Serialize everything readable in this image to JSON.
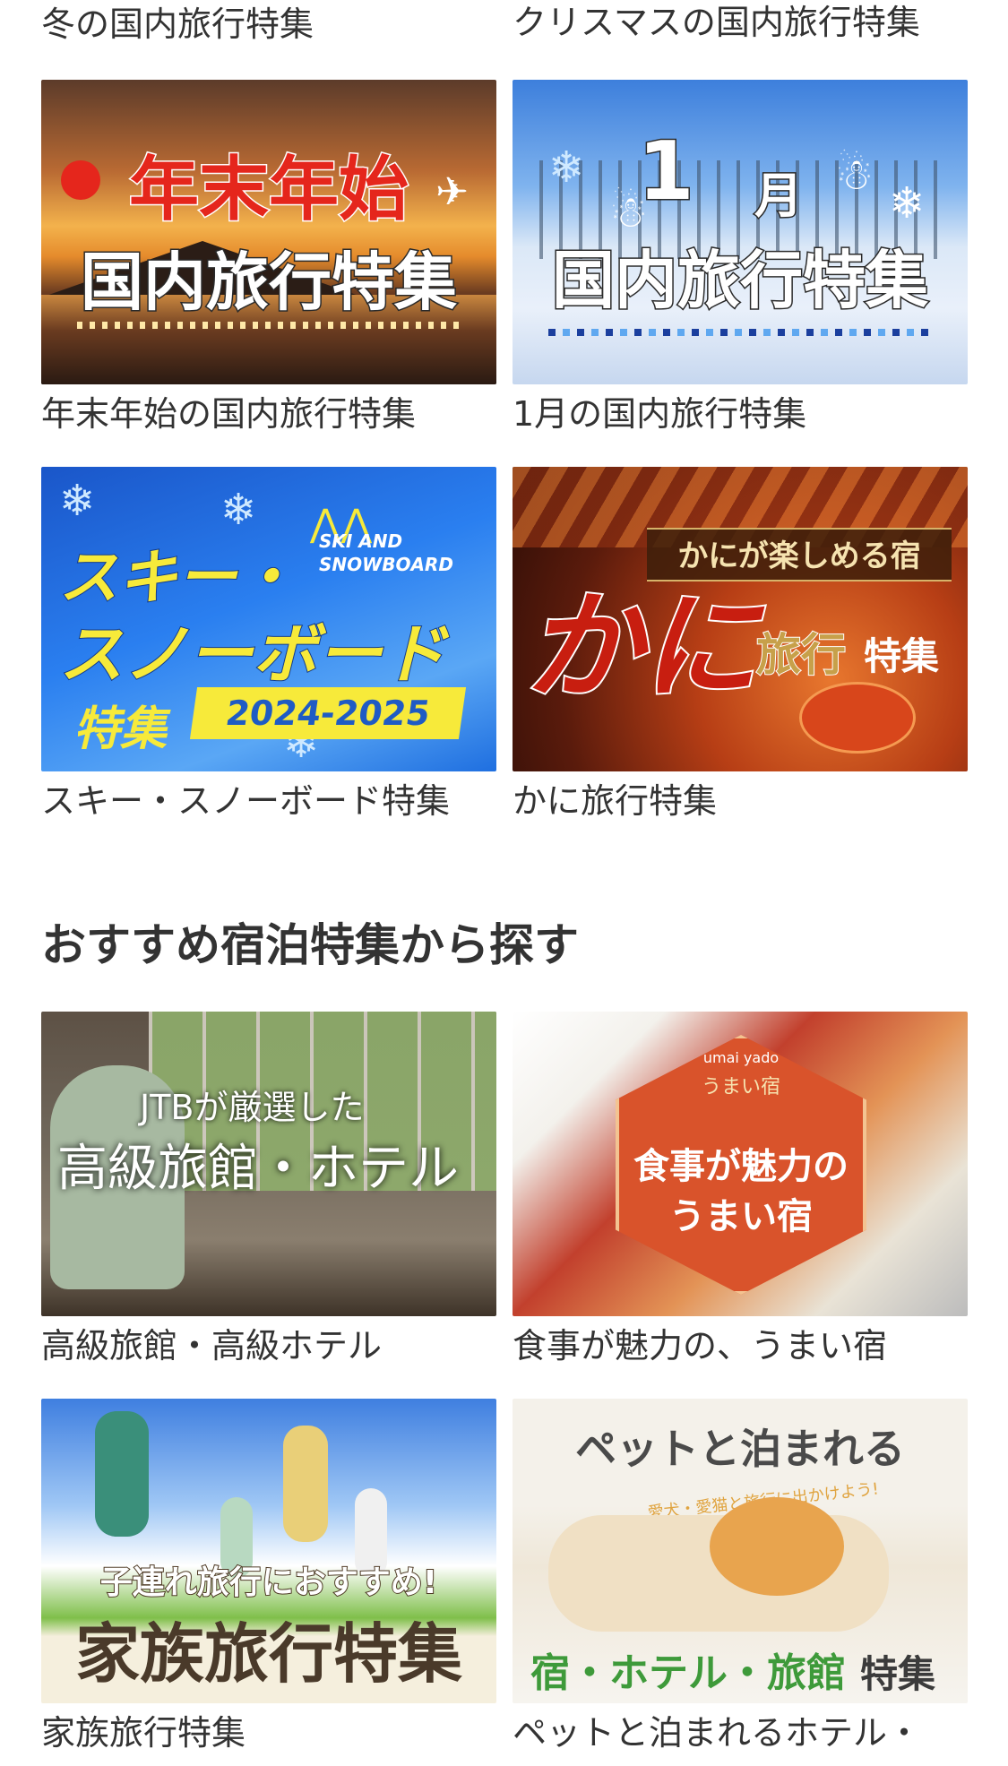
{
  "top_captions": {
    "left": "冬の国内旅行特集",
    "right": "クリスマスの国内旅行特集"
  },
  "cards_top": [
    {
      "caption": "年末年始の国内旅行特集",
      "banner": {
        "line1": "年末年始",
        "line2": "国内旅行特集"
      }
    },
    {
      "caption": "1月の国内旅行特集",
      "banner": {
        "line1": "1",
        "line1b": "月",
        "line2": "国内旅行特集"
      }
    },
    {
      "caption": "スキー・スノーボード特集",
      "banner": {
        "line1": "スキー・",
        "line2": "スノーボード",
        "line3": "特集",
        "en": "SKI AND SNOWBOARD",
        "season": "2024-2025"
      }
    },
    {
      "caption": "かに旅行特集",
      "banner": {
        "tag": "かにが楽しめる宿",
        "big": "かに",
        "sub": "旅行",
        "sub2": "特集"
      }
    }
  ],
  "section": {
    "title": "おすすめ宿泊特集から探す"
  },
  "cards_bottom": [
    {
      "caption": "高級旅館・高級ホテル",
      "banner": {
        "line1": "JTBが厳選した",
        "line2": "高級旅館・ホテル"
      }
    },
    {
      "caption": "食事が魅力の、うまい宿",
      "banner": {
        "small": "umai yado",
        "line1": "食事が魅力の",
        "line2": "うまい宿",
        "logo": "うまい宿"
      }
    },
    {
      "caption": "家族旅行特集",
      "banner": {
        "line1": "子連れ旅行におすすめ!",
        "line2": "家族旅行特集"
      }
    },
    {
      "caption": "ペットと泊まれるホテル・",
      "banner": {
        "line1": "ペットと泊まれる",
        "sub": "愛犬・愛猫と旅行に出かけよう!",
        "line2": "宿・ホテル・旅館",
        "line3": "特集"
      }
    }
  ],
  "colors": {
    "text": "#333333",
    "ski_blue": "#1f6fe0",
    "ski_yellow": "#f7ea3a",
    "kani_red": "#c81e10",
    "umai_orange": "#d9532b",
    "pet_green": "#3e9a3a",
    "new_year_red": "#e5261c"
  }
}
